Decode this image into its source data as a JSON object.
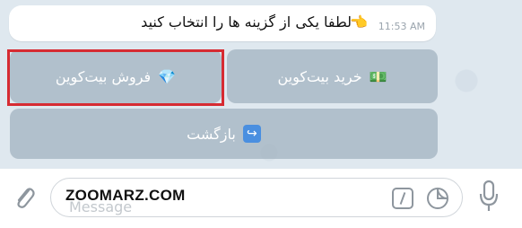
{
  "message": {
    "text": "لطفا یکی از گزینه ها را انتخاب کنید",
    "emoji": "👈",
    "time": "11:53 AM"
  },
  "keyboard": {
    "buy": {
      "label": "خرید بیت‌کوین",
      "emoji": "💵"
    },
    "sell": {
      "label": "فروش بیت‌کوین",
      "emoji": "💎"
    },
    "back": {
      "label": "بازگشت",
      "emoji": "↪"
    }
  },
  "composer": {
    "placeholder": "Message",
    "watermark": "ZOOMARZ.COM"
  },
  "colors": {
    "highlight": "#d62b32",
    "button_bg": "#a0b0be"
  }
}
